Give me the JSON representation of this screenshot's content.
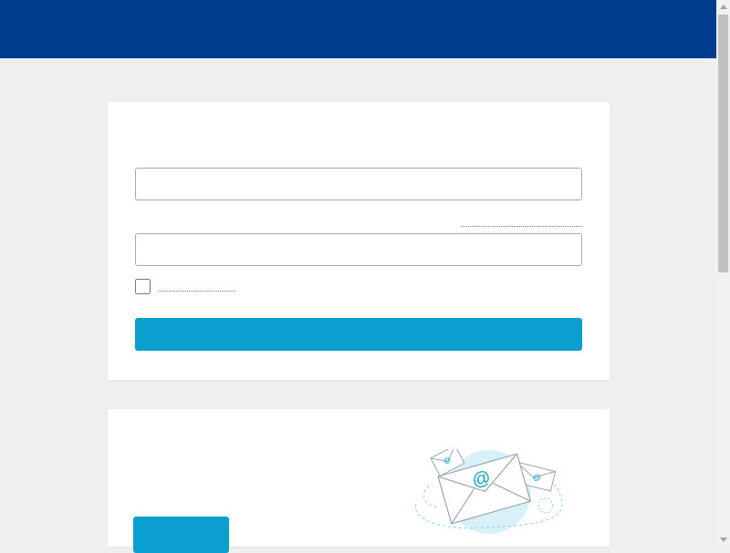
{
  "header": {
    "color": "#003f8f"
  },
  "login": {
    "title": "",
    "username_label": "",
    "username_value": "",
    "username_placeholder": "",
    "password_label": "",
    "forgot_link": "",
    "password_value": "",
    "password_placeholder": "",
    "remember_label": "",
    "submit_label": ""
  },
  "promo": {
    "title": "",
    "button_label": "",
    "illustration_icon": "email-envelopes-icon"
  },
  "colors": {
    "accent": "#0b9fd0",
    "page_background": "#efefef"
  }
}
